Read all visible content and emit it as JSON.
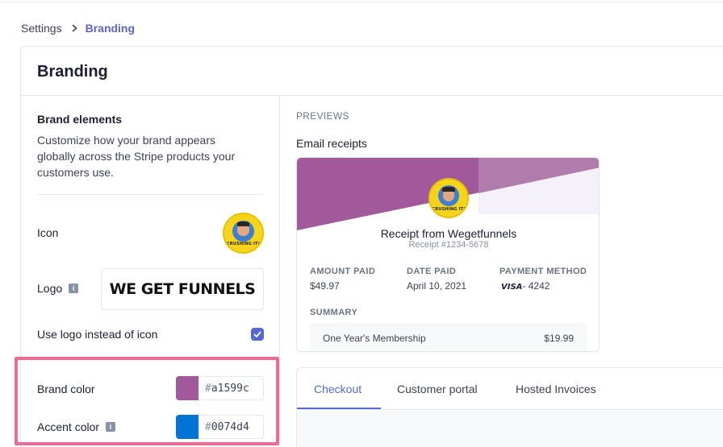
{
  "breadcrumb": {
    "parent": "Settings",
    "separator": "›",
    "current": "Branding"
  },
  "page": {
    "title": "Branding"
  },
  "brand_elements": {
    "title": "Brand elements",
    "description": "Customize how your brand appears globally across the Stripe products your customers use.",
    "icon_label": "Icon",
    "avatar_caption": "CRUSHING IT!",
    "logo_label": "Logo",
    "logo_text": "WE GET FUNNELS",
    "use_logo_label": "Use logo instead of icon",
    "use_logo_checked": true
  },
  "colors": {
    "brand_label": "Brand color",
    "brand_hash": "#",
    "brand_value": "a1599c",
    "brand_hex": "#a1599c",
    "accent_label": "Accent color",
    "accent_hash": "#",
    "accent_value": "0074d4",
    "accent_hex": "#0074d4",
    "highlight": "#f06b93"
  },
  "previews": {
    "section_label": "PREVIEWS",
    "email_title": "Email receipts",
    "receipt": {
      "from": "Receipt from Wegetfunnels",
      "number": "Receipt #1234-5678",
      "amount_paid_label": "AMOUNT PAID",
      "amount_paid": "$49.97",
      "date_paid_label": "DATE PAID",
      "date_paid": "April 10, 2021",
      "payment_method_label": "PAYMENT METHOD",
      "card_brand": "VISA",
      "card_last4": "- 4242",
      "summary_label": "SUMMARY",
      "item_name": "One Year's Membership",
      "item_price": "$19.99"
    },
    "tabs": [
      {
        "label": "Checkout",
        "active": true
      },
      {
        "label": "Customer portal",
        "active": false
      },
      {
        "label": "Hosted Invoices",
        "active": false
      }
    ]
  }
}
